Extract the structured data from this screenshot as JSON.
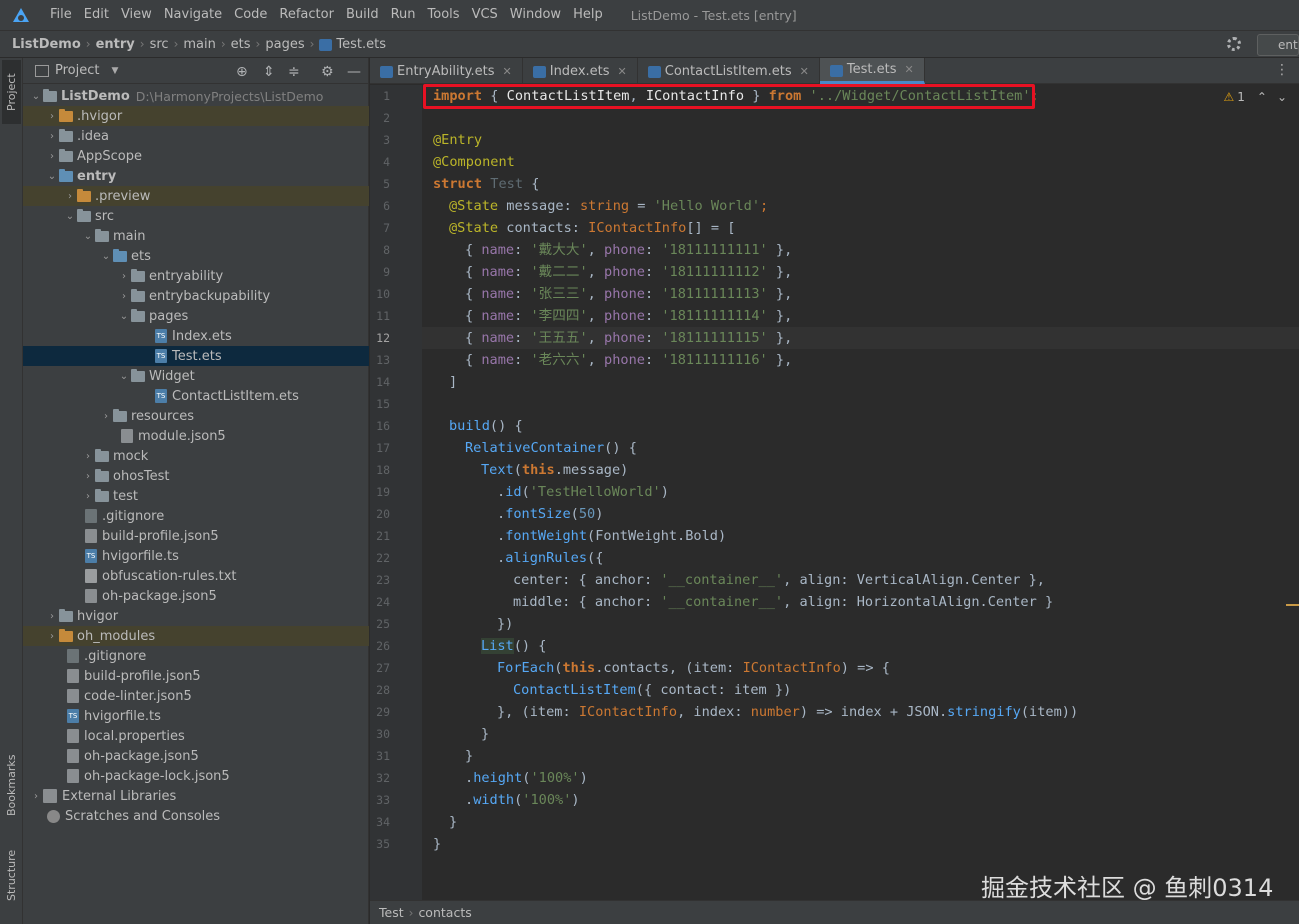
{
  "menubar": {
    "items": [
      "File",
      "Edit",
      "View",
      "Navigate",
      "Code",
      "Refactor",
      "Build",
      "Run",
      "Tools",
      "VCS",
      "Window",
      "Help"
    ],
    "mnemonics": [
      "F",
      "E",
      "V",
      "N",
      "C",
      "R",
      "B",
      "u",
      "T",
      "S",
      "W",
      "H"
    ],
    "window_title": "ListDemo - Test.ets [entry]"
  },
  "navbar": {
    "crumbs": [
      "ListDemo",
      "entry",
      "src",
      "main",
      "ets",
      "pages",
      "Test.ets"
    ],
    "run_config": "ent"
  },
  "left_stripe": {
    "top_tab": "Project",
    "bottom_tabs": [
      "Bookmarks",
      "Structure"
    ]
  },
  "project_panel": {
    "title": "Project",
    "rows": [
      {
        "label": "ListDemo",
        "extra": "D:\\HarmonyProjects\\ListDemo",
        "bold": true
      },
      {
        "label": ".hvigor"
      },
      {
        "label": ".idea"
      },
      {
        "label": "AppScope"
      },
      {
        "label": "entry",
        "bold": true
      },
      {
        "label": ".preview"
      },
      {
        "label": "src"
      },
      {
        "label": "main"
      },
      {
        "label": "ets"
      },
      {
        "label": "entryability"
      },
      {
        "label": "entrybackupability"
      },
      {
        "label": "pages"
      },
      {
        "label": "Index.ets"
      },
      {
        "label": "Test.ets"
      },
      {
        "label": "Widget"
      },
      {
        "label": "ContactListItem.ets"
      },
      {
        "label": "resources"
      },
      {
        "label": "module.json5"
      },
      {
        "label": "mock"
      },
      {
        "label": "ohosTest"
      },
      {
        "label": "test"
      },
      {
        "label": ".gitignore"
      },
      {
        "label": "build-profile.json5"
      },
      {
        "label": "hvigorfile.ts"
      },
      {
        "label": "obfuscation-rules.txt"
      },
      {
        "label": "oh-package.json5"
      },
      {
        "label": "hvigor"
      },
      {
        "label": "oh_modules"
      },
      {
        "label": ".gitignore"
      },
      {
        "label": "build-profile.json5"
      },
      {
        "label": "code-linter.json5"
      },
      {
        "label": "hvigorfile.ts"
      },
      {
        "label": "local.properties"
      },
      {
        "label": "oh-package.json5"
      },
      {
        "label": "oh-package-lock.json5"
      },
      {
        "label": "External Libraries"
      },
      {
        "label": "Scratches and Consoles"
      }
    ]
  },
  "editor_tabs": [
    "EntryAbility.ets",
    "Index.ets",
    "ContactListItem.ets",
    "Test.ets"
  ],
  "code": {
    "line1": [
      "import",
      " { ",
      "ContactListItem",
      ", ",
      "IContactInfo",
      " } ",
      "from",
      " '../Widget/ContactListItem'",
      ";"
    ],
    "line3": "@Entry",
    "line4": "@Component",
    "line5": [
      "struct",
      " ",
      "Test",
      " {"
    ],
    "line6": [
      "@State",
      " message: ",
      "string",
      " = ",
      "'Hello World'",
      ";"
    ],
    "line7": [
      "@State",
      " contacts: ",
      "IContactInfo",
      "[] = ["
    ],
    "contacts": [
      {
        "name": "'戴大大'",
        "phone": "'18111111111'"
      },
      {
        "name": "'戴二二'",
        "phone": "'18111111112'"
      },
      {
        "name": "'张三三'",
        "phone": "'18111111113'"
      },
      {
        "name": "'李四四'",
        "phone": "'18111111114'"
      },
      {
        "name": "'王五五'",
        "phone": "'18111111115'"
      },
      {
        "name": "'老六六'",
        "phone": "'18111111116'"
      }
    ],
    "k_name": "name",
    "k_phone": "phone",
    "line14": "]",
    "line16": [
      "build",
      "() {"
    ],
    "line17": [
      "RelativeContainer",
      "() {"
    ],
    "line18": [
      "Text",
      "(",
      "this",
      ".message)"
    ],
    "line19": [
      ".",
      "id",
      "(",
      "'TestHelloWorld'",
      ")"
    ],
    "line20": [
      ".",
      "fontSize",
      "(",
      "50",
      ")"
    ],
    "line21": [
      ".",
      "fontWeight",
      "(FontWeight.Bold)"
    ],
    "line22": [
      ".",
      "alignRules",
      "({"
    ],
    "line23": [
      "center: { anchor: ",
      "'__container__'",
      ", align: VerticalAlign.Center },"
    ],
    "line24": [
      "middle: { anchor: ",
      "'__container__'",
      ", align: HorizontalAlign.Center }"
    ],
    "line25": "})",
    "line26": [
      "List",
      "() {"
    ],
    "line27": [
      "ForEach",
      "(",
      "this",
      ".contacts, (item: ",
      "IContactInfo",
      ") => {"
    ],
    "line28": [
      "ContactListItem",
      "({ contact: item })"
    ],
    "line29": [
      "}, (item: ",
      "IContactInfo",
      ", index: ",
      "number",
      ") => index + JSON.",
      "stringify",
      "(item))"
    ],
    "line30": "}",
    "line31": "}",
    "line32": [
      ".",
      "height",
      "(",
      "'100%'",
      ")"
    ],
    "line33": [
      ".",
      "width",
      "(",
      "'100%'",
      ")"
    ],
    "line34": "}",
    "line35": "}",
    "line_numbers": [
      "1",
      "2",
      "3",
      "4",
      "5",
      "6",
      "7",
      "8",
      "9",
      "10",
      "11",
      "12",
      "13",
      "14",
      "15",
      "16",
      "17",
      "18",
      "19",
      "20",
      "21",
      "22",
      "23",
      "24",
      "25",
      "26",
      "27",
      "28",
      "29",
      "30",
      "31",
      "32",
      "33",
      "34",
      "35"
    ]
  },
  "inspection": {
    "warnings": "1"
  },
  "status": {
    "crumbs": [
      "Test",
      "contacts"
    ]
  },
  "watermark": "掘金技术社区 @ 鱼刺0314",
  "colors": {
    "accent": "#4a88c7",
    "highlight_box": "#e81123",
    "bg": "#2b2b2b"
  }
}
